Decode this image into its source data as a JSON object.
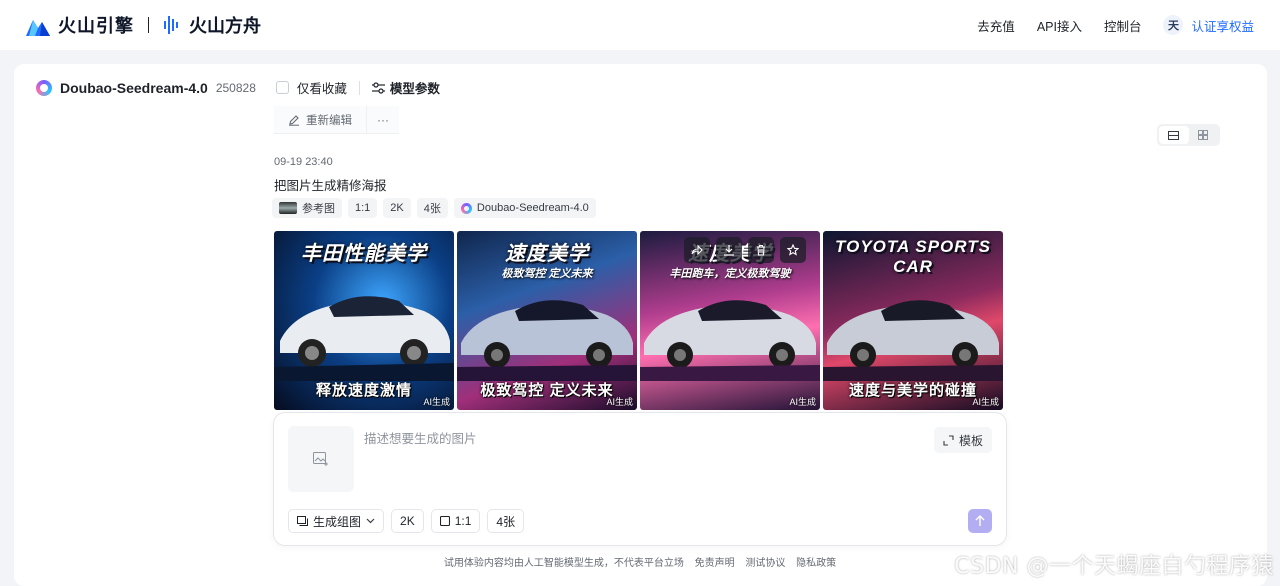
{
  "header": {
    "brand": "火山引擎",
    "product": "火山方舟",
    "nav": [
      "去充值",
      "API接入",
      "控制台"
    ],
    "avatar_char": "天",
    "auth_label": "认证享权益"
  },
  "model": {
    "name": "Doubao-Seedream-4.0",
    "version": "250828",
    "favorites_label": "仅看收藏",
    "params_label": "模型参数"
  },
  "actions": {
    "re_edit": "重新编辑",
    "more": "···"
  },
  "record": {
    "timestamp": "09-19 23:40",
    "prompt": "把图片生成精修海报",
    "chips": {
      "reference": "参考图",
      "ratio": "1:1",
      "resolution": "2K",
      "count": "4张",
      "model": "Doubao-Seedream-4.0"
    }
  },
  "images": [
    {
      "title": "丰田性能美学",
      "subtitle": "",
      "caption": "释放速度激情",
      "ai_tag": "AI生成"
    },
    {
      "title": "速度美学",
      "subtitle": "极致驾控 定义未来",
      "caption": "极致驾控 定义未来",
      "ai_tag": "AI生成"
    },
    {
      "title": "速度美学",
      "subtitle": "丰田跑车，定义极致驾驶",
      "caption": "",
      "ai_tag": "AI生成"
    },
    {
      "title": "TOYOTA SPORTS CAR",
      "subtitle": "",
      "caption": "速度与美学的碰撞",
      "ai_tag": "AI生成"
    }
  ],
  "composer": {
    "placeholder": "描述想要生成的图片",
    "template_label": "模板",
    "mode_label": "生成组图",
    "resolution": "2K",
    "ratio": "1:1",
    "count": "4张"
  },
  "footer": {
    "disclaimer": "试用体验内容均由人工智能模型生成，不代表平台立场",
    "links": [
      "免责声明",
      "测试协议",
      "隐私政策"
    ]
  },
  "watermark": "CSDN @一个天蝎座白勺程序猿",
  "colors": {
    "accent": "#1f6bff",
    "send_button": "#b3aef2"
  }
}
